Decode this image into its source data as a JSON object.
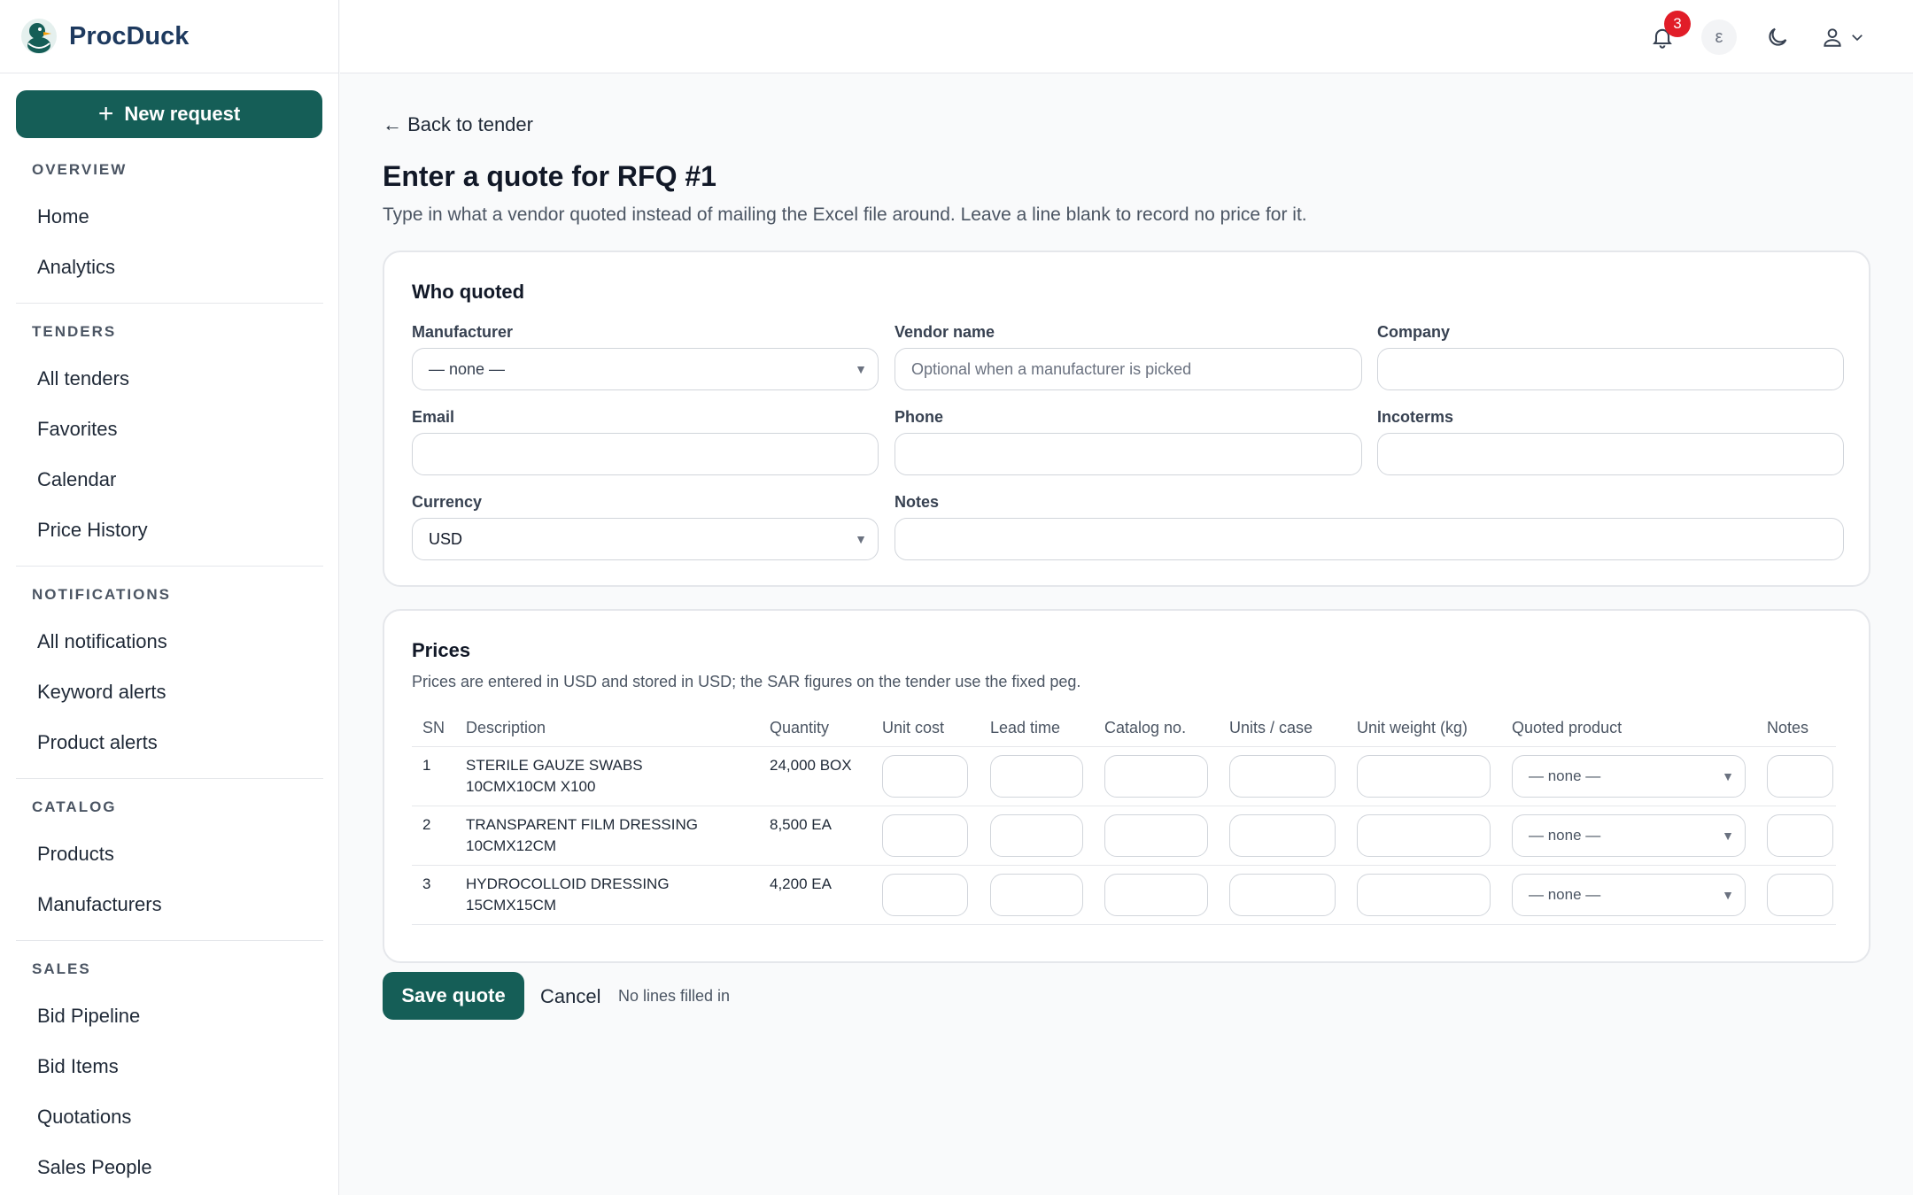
{
  "app": {
    "name": "ProcDuck"
  },
  "sidebar": {
    "new_request": "New request",
    "sections": [
      {
        "heading": "OVERVIEW",
        "items": [
          "Home",
          "Analytics"
        ]
      },
      {
        "heading": "TENDERS",
        "items": [
          "All tenders",
          "Favorites",
          "Calendar",
          "Price History"
        ]
      },
      {
        "heading": "NOTIFICATIONS",
        "items": [
          "All notifications",
          "Keyword alerts",
          "Product alerts"
        ]
      },
      {
        "heading": "CATALOG",
        "items": [
          "Products",
          "Manufacturers"
        ]
      },
      {
        "heading": "SALES",
        "items": [
          "Bid Pipeline",
          "Bid Items",
          "Quotations",
          "Sales People"
        ]
      }
    ]
  },
  "topbar": {
    "notification_count": "3",
    "language_label": "ε",
    "icons": [
      "bell-icon",
      "moon-icon",
      "user-icon",
      "chevron-down-icon"
    ]
  },
  "page": {
    "back_link": "← Back to tender",
    "title": "Enter a quote for RFQ #1",
    "subtitle": "Type in what a vendor quoted instead of mailing the Excel file around. Leave a line blank to record no price for it."
  },
  "who_quoted": {
    "title": "Who quoted",
    "manufacturer_label": "Manufacturer",
    "manufacturer_value": "— none —",
    "vendor_label": "Vendor name",
    "vendor_placeholder": "Optional when a manufacturer is picked",
    "company_label": "Company",
    "email_label": "Email",
    "phone_label": "Phone",
    "incoterms_label": "Incoterms",
    "currency_label": "Currency",
    "currency_value": "USD",
    "notes_label": "Notes"
  },
  "prices": {
    "title": "Prices",
    "note": "Prices are entered in USD and stored in USD; the SAR figures on the tender use the fixed peg.",
    "columns": [
      "SN",
      "Description",
      "Quantity",
      "Unit cost",
      "Lead time",
      "Catalog no.",
      "Units / case",
      "Unit weight (kg)",
      "Quoted product",
      "Notes"
    ],
    "rows": [
      {
        "sn": "1",
        "desc1": "STERILE GAUZE SWABS",
        "desc2": "10CMX10CM X100",
        "qty": "24,000 BOX",
        "product": "— none —"
      },
      {
        "sn": "2",
        "desc1": "TRANSPARENT FILM DRESSING",
        "desc2": "10CMX12CM",
        "qty": "8,500 EA",
        "product": "— none —"
      },
      {
        "sn": "3",
        "desc1": "HYDROCOLLOID DRESSING",
        "desc2": "15CMX15CM",
        "qty": "4,200 EA",
        "product": "— none —"
      }
    ]
  },
  "actions": {
    "save": "Save quote",
    "cancel": "Cancel",
    "status": "No lines filled in"
  },
  "colors": {
    "brand": "#155e57",
    "badge": "#e11d28"
  }
}
